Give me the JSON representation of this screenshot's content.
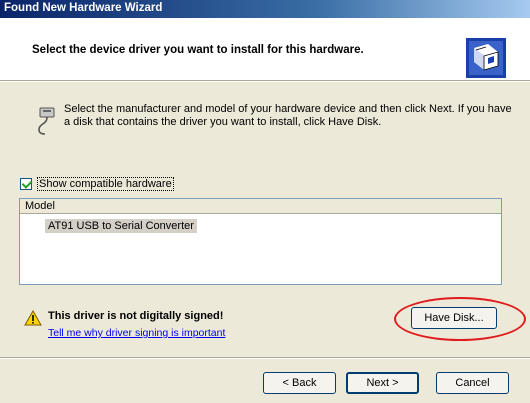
{
  "window": {
    "title": "Found New Hardware Wizard"
  },
  "header": {
    "heading": "Select the device driver you want to install for this hardware.",
    "icon": "hardware-wizard-icon"
  },
  "intro": {
    "text": "Select the manufacturer and model of your hardware device and then click Next. If you have a disk that contains the driver you want to install, click Have Disk.",
    "icon": "serial-plug-icon"
  },
  "compatible": {
    "checked": true,
    "label": "Show compatible hardware"
  },
  "model_list": {
    "header": "Model",
    "items": [
      "AT91 USB to Serial Converter"
    ]
  },
  "warning": {
    "icon": "warning-icon",
    "text": "This driver is not digitally signed!",
    "link": "Tell me why driver signing is important"
  },
  "buttons": {
    "have_disk": "Have Disk...",
    "back": "< Back",
    "next": "Next >",
    "cancel": "Cancel"
  },
  "colors": {
    "title_bar": "#0a246a",
    "annotation_circle": "#e01b1b",
    "window_bg": "#ece9d8"
  }
}
